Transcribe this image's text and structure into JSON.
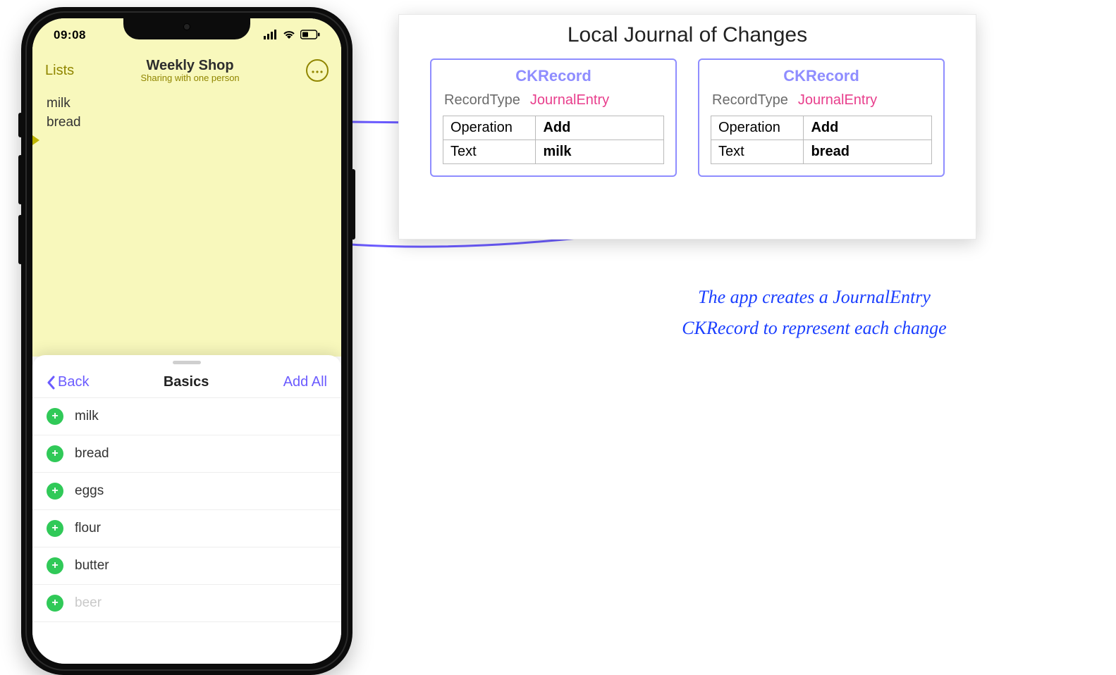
{
  "phone": {
    "status": {
      "time": "09:08"
    },
    "header": {
      "back_label": "Lists",
      "title": "Weekly Shop",
      "subtitle": "Sharing with one person"
    },
    "note_items": [
      "milk",
      "bread"
    ],
    "sheet": {
      "back_label": "Back",
      "title": "Basics",
      "action_label": "Add All",
      "rows": [
        "milk",
        "bread",
        "eggs",
        "flour",
        "butter",
        "beer"
      ]
    }
  },
  "journal": {
    "title": "Local Journal of Changes",
    "record_head": "CKRecord",
    "record_type_label": "RecordType",
    "record_type_value": "JournalEntry",
    "field_operation_label": "Operation",
    "field_text_label": "Text",
    "records": [
      {
        "operation": "Add",
        "text": "milk"
      },
      {
        "operation": "Add",
        "text": "bread"
      }
    ]
  },
  "annotation": {
    "line1": "The app creates a JournalEntry",
    "line2": "CKRecord to represent each change"
  }
}
